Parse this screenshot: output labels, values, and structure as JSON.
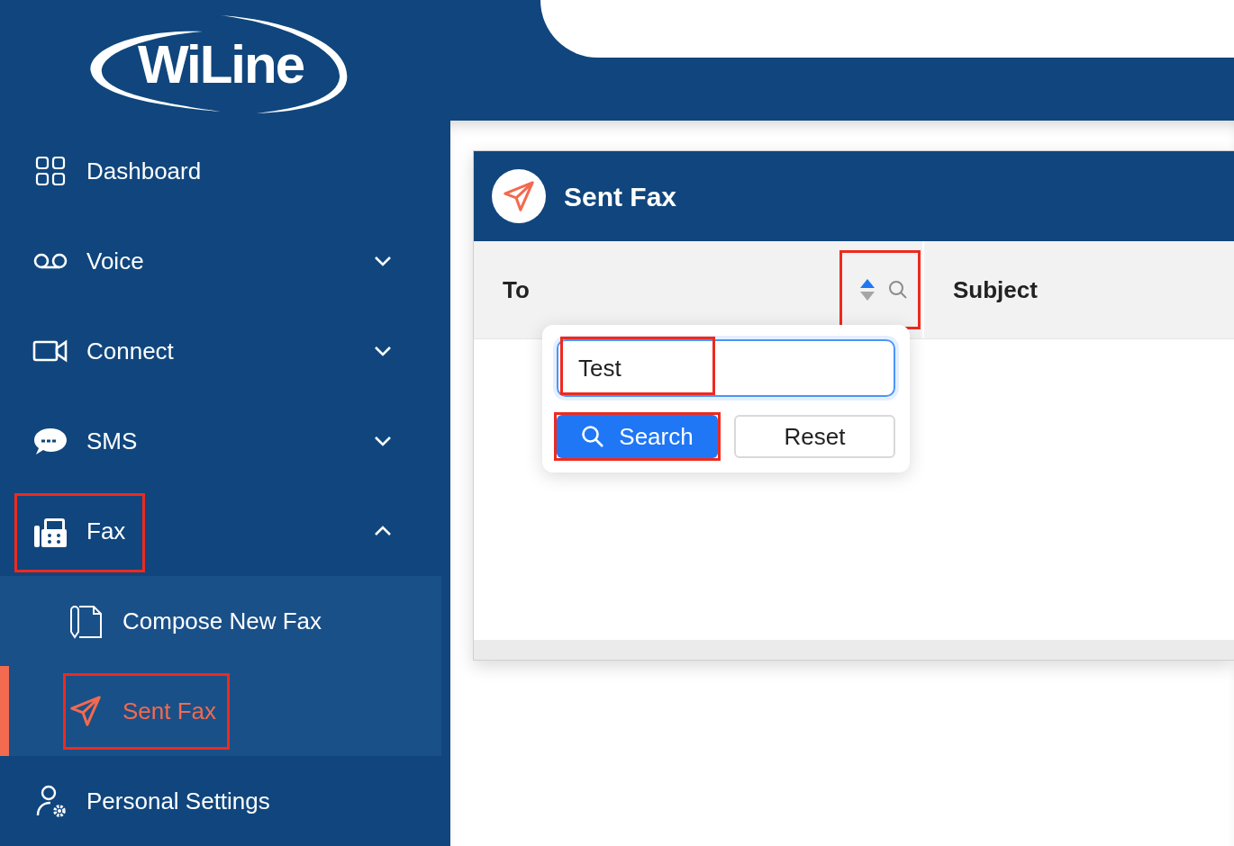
{
  "logo": {
    "text": "WiLine"
  },
  "sidebar": {
    "items": [
      {
        "label": "Dashboard",
        "kind": "link",
        "highlighted": false
      },
      {
        "label": "Voice",
        "kind": "group",
        "expanded": false,
        "highlighted": false
      },
      {
        "label": "Connect",
        "kind": "group",
        "expanded": false,
        "highlighted": false
      },
      {
        "label": "SMS",
        "kind": "group",
        "expanded": false,
        "highlighted": false
      },
      {
        "label": "Fax",
        "kind": "group",
        "expanded": true,
        "highlighted": true,
        "children": [
          {
            "label": "Compose New Fax",
            "selected": false,
            "highlighted": false
          },
          {
            "label": "Sent Fax",
            "selected": true,
            "highlighted": true
          }
        ]
      },
      {
        "label": "Personal Settings",
        "kind": "link",
        "highlighted": false
      }
    ]
  },
  "card": {
    "title": "Sent Fax",
    "table": {
      "columns": [
        {
          "label": "To",
          "sort_ascending": true,
          "highlighted": true,
          "filter_open": true
        },
        {
          "label": "Subject"
        }
      ]
    },
    "filter_popup": {
      "value": "Test",
      "value_highlighted": true,
      "buttons": [
        {
          "label": "Search",
          "kind": "primary",
          "highlighted": true
        },
        {
          "label": "Reset",
          "kind": "default",
          "highlighted": false
        }
      ]
    }
  }
}
